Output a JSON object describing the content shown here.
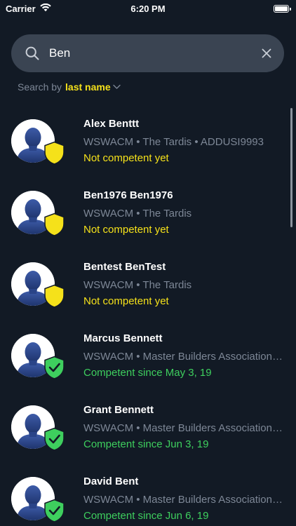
{
  "status_bar": {
    "carrier": "Carrier",
    "time": "6:20 PM"
  },
  "search": {
    "value": "Ben",
    "search_by_prefix": "Search by",
    "search_by_field": "last name"
  },
  "results": [
    {
      "name": "Alex Benttt",
      "meta": "WSWACM • The Tardis • ADDUSI9993",
      "status": "Not competent yet",
      "competent": false
    },
    {
      "name": "Ben1976 Ben1976",
      "meta": "WSWACM • The Tardis",
      "status": "Not competent yet",
      "competent": false
    },
    {
      "name": "Bentest BenTest",
      "meta": "WSWACM • The Tardis",
      "status": "Not competent yet",
      "competent": false
    },
    {
      "name": "Marcus Bennett",
      "meta": "WSWACM • Master Builders Association - WA",
      "status": "Competent since May 3, 19",
      "competent": true
    },
    {
      "name": "Grant Bennett",
      "meta": "WSWACM • Master Builders Association - WA",
      "status": "Competent since Jun 3, 19",
      "competent": true
    },
    {
      "name": "David Bent",
      "meta": "WSWACM • Master Builders Association - WA",
      "status": "Competent since Jun 6, 19",
      "competent": true
    }
  ],
  "colors": {
    "background": "#121a25",
    "search_bg": "#3a4452",
    "accent_yellow": "#f5e11a",
    "accent_green": "#3ecf5e",
    "muted_text": "#7d8796"
  },
  "icons": {
    "wifi": "wifi-icon",
    "battery": "battery-icon",
    "search": "search-icon",
    "clear": "close-icon",
    "dropdown": "chevron-down-icon",
    "pending_badge": "shield-icon",
    "competent_badge": "shield-check-icon"
  }
}
